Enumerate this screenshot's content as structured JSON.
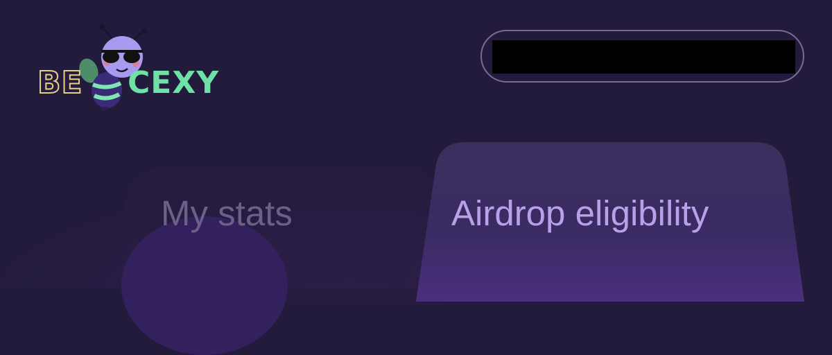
{
  "brand": {
    "logo_left_text": "BE",
    "logo_right_text": "CEXY",
    "mascot_icon": "bee-with-sunglasses-icon"
  },
  "header": {
    "wallet_address": ""
  },
  "tabs": [
    {
      "label": "My stats",
      "active": false
    },
    {
      "label": "Airdrop eligibility",
      "active": true
    }
  ],
  "colors": {
    "background": "#231b3c",
    "accent": "#b7a2ea",
    "inactive_tab_text": "#6c5f88",
    "logo_green": "#6fe0a6",
    "logo_yellow": "#e8cf86",
    "mascot_purple": "#a79bef"
  }
}
